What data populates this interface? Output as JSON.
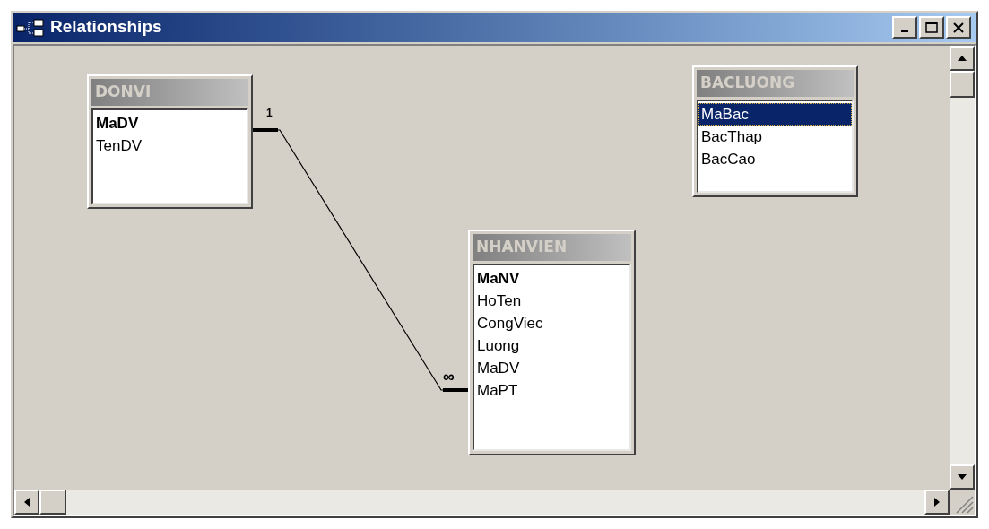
{
  "window": {
    "title": "Relationships"
  },
  "tables": [
    {
      "name": "DONVI",
      "fields": [
        {
          "name": "MaDV",
          "primary_key": true,
          "selected": false
        },
        {
          "name": "TenDV",
          "primary_key": false,
          "selected": false
        }
      ]
    },
    {
      "name": "BACLUONG",
      "fields": [
        {
          "name": "MaBac",
          "primary_key": false,
          "selected": true
        },
        {
          "name": "BacThap",
          "primary_key": false,
          "selected": false
        },
        {
          "name": "BacCao",
          "primary_key": false,
          "selected": false
        }
      ]
    },
    {
      "name": "NHANVIEN",
      "fields": [
        {
          "name": "MaNV",
          "primary_key": true,
          "selected": false
        },
        {
          "name": "HoTen",
          "primary_key": false,
          "selected": false
        },
        {
          "name": "CongViec",
          "primary_key": false,
          "selected": false
        },
        {
          "name": "Luong",
          "primary_key": false,
          "selected": false
        },
        {
          "name": "MaDV",
          "primary_key": false,
          "selected": false
        },
        {
          "name": "MaPT",
          "primary_key": false,
          "selected": false
        }
      ]
    }
  ],
  "relationships": [
    {
      "one_label": "1",
      "many_label": "∞"
    }
  ]
}
